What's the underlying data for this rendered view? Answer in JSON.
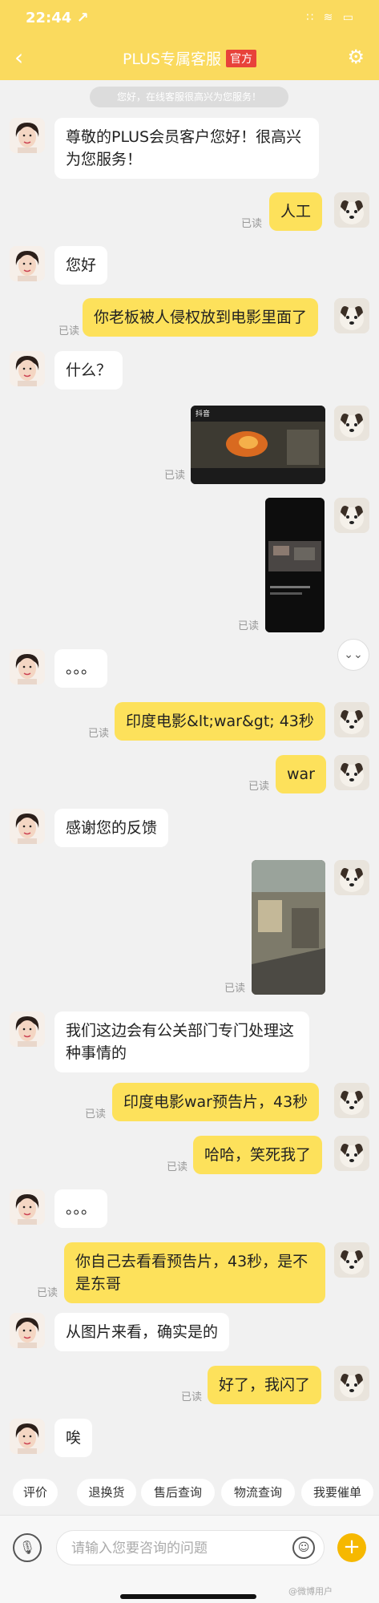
{
  "status": {
    "time": "22:44 ↗",
    "icons": "∷ ≋ ▭"
  },
  "nav": {
    "back": "‹",
    "title": "PLUS专属客服",
    "badge": "官方",
    "settings_icon": "⚙"
  },
  "notice": "您好，在线客服很高兴为您服务！",
  "messages": {
    "m1": "尊敬的PLUS会员客户您好！很高兴为您服务！",
    "m2": "人工",
    "m3": "您好",
    "m4": "你老板被人侵权放到电影里面了",
    "m5": "什么？",
    "m8": "。。。",
    "m9": "印度电影&lt;war&gt; 43秒",
    "m10": "war",
    "m11": "感谢您的反馈",
    "m13": "我们这边会有公关部门专门处理这种事情的",
    "m14": "印度电影war预告片，43秒",
    "m15": "哈哈，笑死我了",
    "m16": "。。。",
    "m17": "你自己去看看预告片，43秒，是不是东哥",
    "m18": "从图片来看，确实是的",
    "m19": "好了，我闪了",
    "m20": "唉"
  },
  "read_label": "已读",
  "media": {
    "app_tag": "抖音"
  },
  "quick_replies": [
    "评价",
    "退换货",
    "售后查询",
    "物流查询",
    "我要催单"
  ],
  "input": {
    "placeholder": "请输入您要咨询的问题"
  },
  "icons": {
    "mic": "🎙",
    "emoji": "☺",
    "plus": "+",
    "scroll_down": "⌄⌄"
  },
  "watermark": "@微博用户"
}
